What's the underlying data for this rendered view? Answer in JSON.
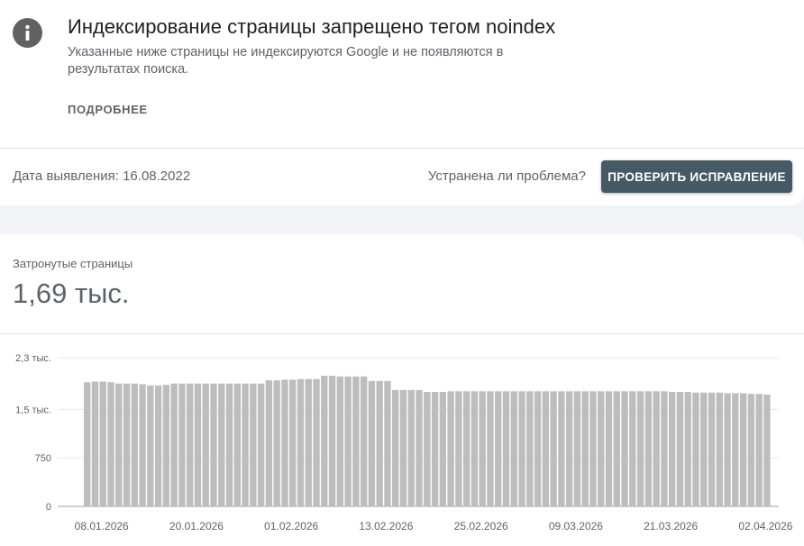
{
  "issue": {
    "title": "Индексирование страницы запрещено тегом noindex",
    "description": "Указанные ниже страницы не индексируются Google и не появляются в результатах поиска.",
    "learn_more": "ПОДРОБНЕЕ"
  },
  "status": {
    "detected": "Дата выявления: 16.08.2022",
    "fixed_question": "Устранена ли проблема?",
    "validate_button": "ПРОВЕРИТЬ ИСПРАВЛЕНИЕ"
  },
  "metric": {
    "label": "Затронутые страницы",
    "value": "1,69 тыс."
  },
  "colors": {
    "bar": "#bdbdbd",
    "button": "#455a64",
    "icon": "#616161"
  },
  "chart_data": {
    "type": "bar",
    "ylim": [
      0,
      2300
    ],
    "yticks": [
      {
        "value": 0,
        "label": "0"
      },
      {
        "value": 750,
        "label": "750"
      },
      {
        "value": 1500,
        "label": "1,5 тыс."
      },
      {
        "value": 2300,
        "label": "2,3 тыс."
      }
    ],
    "xticks": [
      {
        "index": 0,
        "label": "08.01.2026"
      },
      {
        "index": 12,
        "label": "20.01.2026"
      },
      {
        "index": 24,
        "label": "01.02.2026"
      },
      {
        "index": 36,
        "label": "13.02.2026"
      },
      {
        "index": 48,
        "label": "25.02.2026"
      },
      {
        "index": 60,
        "label": "09.03.2026"
      },
      {
        "index": 72,
        "label": "21.03.2026"
      },
      {
        "index": 84,
        "label": "02.04.2026"
      }
    ],
    "values": [
      1920,
      1930,
      1930,
      1920,
      1900,
      1900,
      1900,
      1890,
      1870,
      1870,
      1880,
      1900,
      1900,
      1900,
      1900,
      1900,
      1900,
      1900,
      1900,
      1900,
      1900,
      1900,
      1900,
      1950,
      1950,
      1960,
      1960,
      1970,
      1970,
      1970,
      2020,
      2020,
      2010,
      2010,
      2010,
      2010,
      1940,
      1940,
      1940,
      1800,
      1800,
      1800,
      1800,
      1770,
      1770,
      1770,
      1780,
      1780,
      1780,
      1780,
      1780,
      1780,
      1780,
      1780,
      1780,
      1780,
      1780,
      1780,
      1780,
      1780,
      1780,
      1780,
      1780,
      1780,
      1780,
      1780,
      1780,
      1780,
      1780,
      1780,
      1780,
      1780,
      1780,
      1780,
      1770,
      1770,
      1770,
      1760,
      1760,
      1760,
      1760,
      1750,
      1750,
      1750,
      1740,
      1740,
      1730
    ]
  }
}
